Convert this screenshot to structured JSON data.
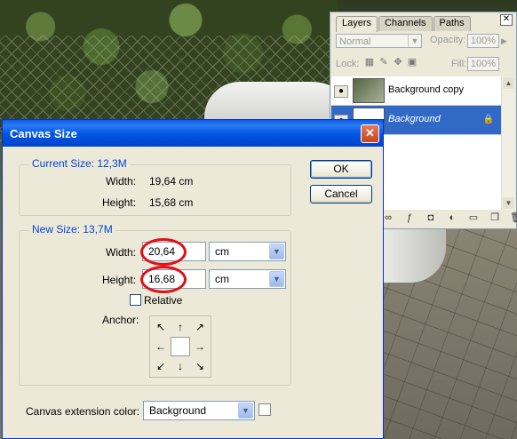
{
  "layers_palette": {
    "tabs": [
      "Layers",
      "Channels",
      "Paths"
    ],
    "active_tab": "Layers",
    "blend_mode": "Normal",
    "opacity_label": "Opacity:",
    "opacity_value": "100%",
    "lock_label": "Lock:",
    "fill_label": "Fill:",
    "fill_value": "100%",
    "layers": [
      {
        "name": "Background copy",
        "selected": false,
        "italic": false,
        "locked": false
      },
      {
        "name": "Background",
        "selected": true,
        "italic": true,
        "locked": true
      }
    ]
  },
  "dialog": {
    "title": "Canvas Size",
    "current_size": {
      "label": "Current Size: 12,3M",
      "width_label": "Width:",
      "width_value": "19,64 cm",
      "height_label": "Height:",
      "height_value": "15,68 cm"
    },
    "new_size": {
      "label": "New Size: 13,7M",
      "width_label": "Width:",
      "width_value": "20,64",
      "width_unit": "cm",
      "height_label": "Height:",
      "height_value": "16,68",
      "height_unit": "cm",
      "relative_label": "Relative",
      "relative_checked": false,
      "anchor_label": "Anchor:"
    },
    "ok_label": "OK",
    "cancel_label": "Cancel",
    "extension_label": "Canvas extension color:",
    "extension_value": "Background",
    "highlight_color": "#e0101a"
  }
}
